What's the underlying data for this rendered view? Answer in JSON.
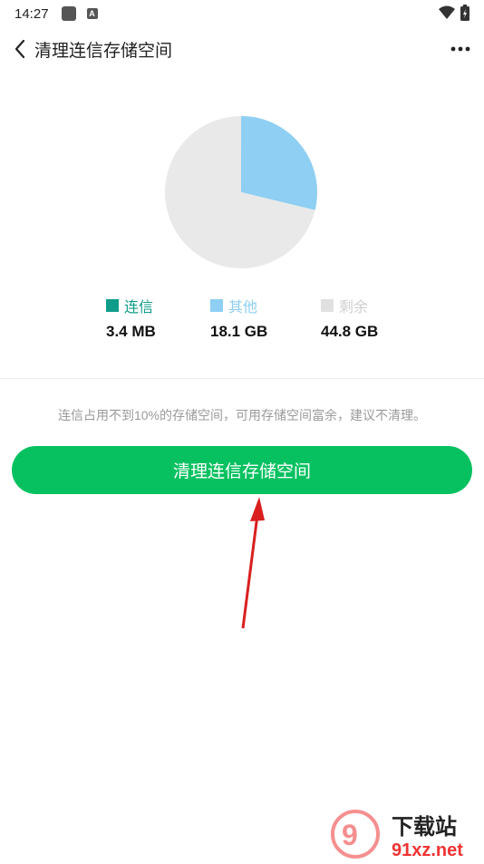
{
  "status_bar": {
    "time": "14:27",
    "badge_letter": "A"
  },
  "header": {
    "title": "清理连信存储空间"
  },
  "chart_data": {
    "type": "pie",
    "title": "",
    "slices": [
      {
        "label": "连信",
        "value_text": "3.4 MB",
        "value_gb": 0.0034,
        "color": "#0f9d8a"
      },
      {
        "label": "其他",
        "value_text": "18.1 GB",
        "value_gb": 18.1,
        "color": "#8ecff3"
      },
      {
        "label": "剩余",
        "value_text": "44.8 GB",
        "value_gb": 44.8,
        "color": "#e9e9e9"
      }
    ]
  },
  "legend": {
    "items": [
      {
        "label": "连信",
        "value": "3.4 MB",
        "color": "#0f9d8a"
      },
      {
        "label": "其他",
        "value": "18.1 GB",
        "color": "#8ecff3"
      },
      {
        "label": "剩余",
        "value": "44.8 GB",
        "color": "#e0e0e0"
      }
    ]
  },
  "notice": "连信占用不到10%的存储空间，可用存储空间富余，建议不清理。",
  "clean_button": {
    "label": "清理连信存储空间",
    "color": "#07c160"
  },
  "annotation": {
    "arrow_color": "#d9201f"
  },
  "watermark": {
    "brand_text": "下载站",
    "domain_text": "91xz.net"
  }
}
